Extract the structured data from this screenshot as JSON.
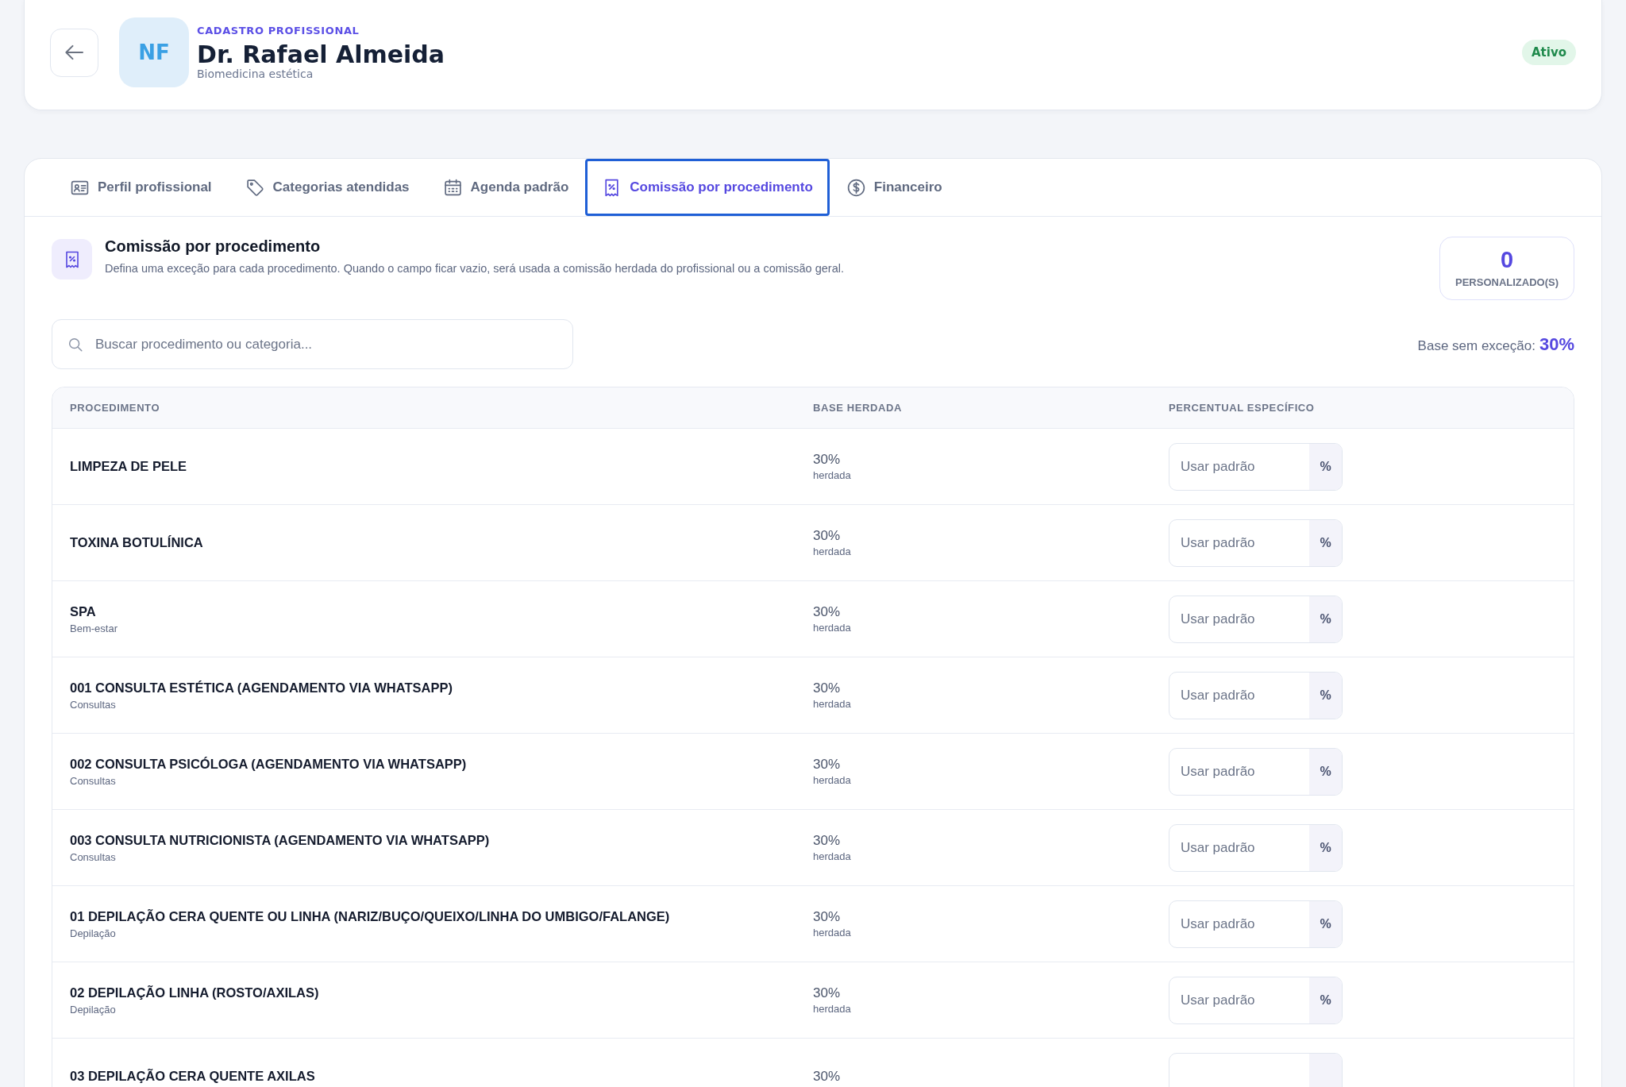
{
  "header": {
    "avatar": "NF",
    "eyebrow": "CADASTRO PROFISSIONAL",
    "name": "Dr. Rafael Almeida",
    "specialty": "Biomedicina estética",
    "status": {
      "label": "Ativo",
      "kind": "active"
    }
  },
  "tabs": [
    {
      "label": "Perfil profissional",
      "selected": false
    },
    {
      "label": "Categorias atendidas",
      "selected": false
    },
    {
      "label": "Agenda padrão",
      "selected": false
    },
    {
      "label": "Comissão por procedimento",
      "selected": true
    },
    {
      "label": "Financeiro",
      "selected": false
    }
  ],
  "section": {
    "title": "Comissão por procedimento",
    "description": "Defina uma exceção para cada procedimento. Quando o campo ficar vazio, será usada a comissão herdada do profissional ou a comissão geral.",
    "counter": {
      "value": "0",
      "label": "PERSONALIZADO(S)"
    },
    "search": {
      "placeholder": "Buscar procedimento ou categoria..."
    },
    "base": {
      "label": "Base sem exceção:",
      "value": "30%"
    }
  },
  "table": {
    "columns": [
      "PROCEDIMENTO",
      "BASE HERDADA",
      "PERCENTUAL ESPECÍFICO"
    ],
    "rows": [
      {
        "name": "LIMPEZA DE PELE",
        "base": "30%",
        "base_note": "herdada",
        "placeholder": "Usar padrão",
        "suffix": "%"
      },
      {
        "name": "TOXINA BOTULÍNICA",
        "base": "30%",
        "base_note": "herdada",
        "placeholder": "Usar padrão",
        "suffix": "%"
      },
      {
        "name": "SPA",
        "category": "Bem-estar",
        "base": "30%",
        "base_note": "herdada",
        "placeholder": "Usar padrão",
        "suffix": "%"
      },
      {
        "name": "001 CONSULTA ESTÉTICA (AGENDAMENTO VIA WHATSAPP)",
        "category": "Consultas",
        "base": "30%",
        "base_note": "herdada",
        "placeholder": "Usar padrão",
        "suffix": "%"
      },
      {
        "name": "002 CONSULTA PSICÓLOGA (AGENDAMENTO VIA WHATSAPP)",
        "category": "Consultas",
        "base": "30%",
        "base_note": "herdada",
        "placeholder": "Usar padrão",
        "suffix": "%"
      },
      {
        "name": "003 CONSULTA NUTRICIONISTA (AGENDAMENTO VIA WHATSAPP)",
        "category": "Consultas",
        "base": "30%",
        "base_note": "herdada",
        "placeholder": "Usar padrão",
        "suffix": "%"
      },
      {
        "name": "01 DEPILAÇÃO CERA QUENTE OU LINHA (NARIZ/BUÇO/QUEIXO/LINHA DO UMBIGO/FALANGE)",
        "category": "Depilação",
        "base": "30%",
        "base_note": "herdada",
        "placeholder": "Usar padrão",
        "suffix": "%"
      },
      {
        "name": "02 DEPILAÇÃO LINHA (ROSTO/AXILAS)",
        "category": "Depilação",
        "base": "30%",
        "base_note": "herdada",
        "placeholder": "Usar padrão",
        "suffix": "%"
      },
      {
        "name": "03 DEPILAÇÃO CERA QUENTE AXILAS",
        "base": "30%"
      }
    ]
  }
}
